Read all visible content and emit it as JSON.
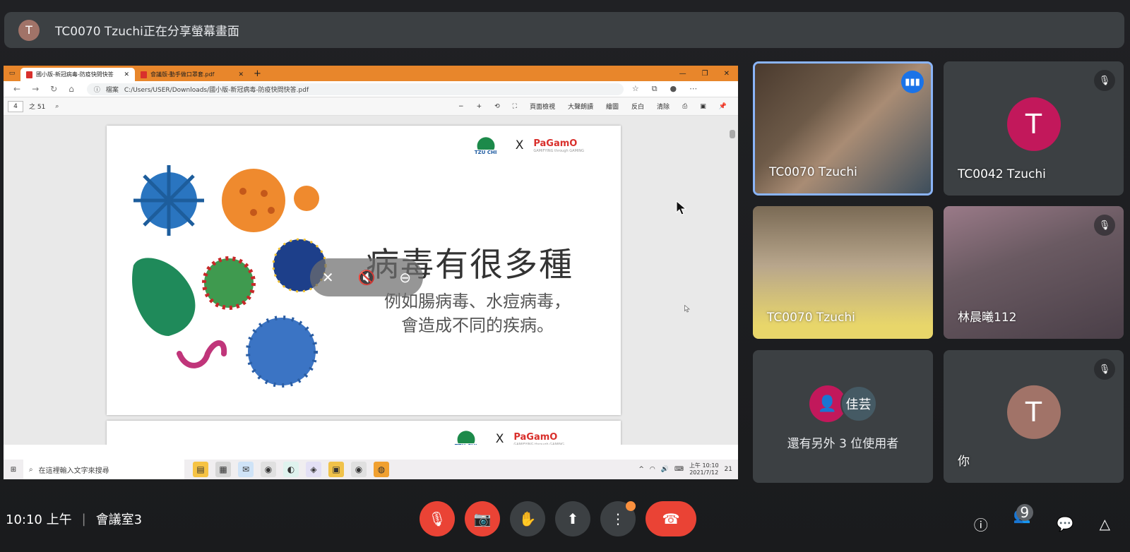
{
  "banner": {
    "avatar_letter": "T",
    "text": "TC0070 Tzuchi正在分享螢幕畫面"
  },
  "browser": {
    "tabs": [
      {
        "label": "國小版-新冠病毒-防疫快問快答"
      },
      {
        "label": "會議版-動手做口罩套.pdf"
      }
    ],
    "address_prefix": "檔案",
    "url": "C:/Users/USER/Downloads/國小版-新冠病毒-防疫快問快答.pdf",
    "page_current": "4",
    "page_total": "之 51",
    "toolbar": {
      "page_view": "頁面檢視",
      "read_aloud": "大聲朗讀",
      "draw": "繪圖",
      "highlight": "反白",
      "erase": "清除"
    }
  },
  "slide": {
    "logo_tzuchi": "TZU CHI",
    "logo_x": "X",
    "logo_pagamo": "PaGamO",
    "logo_pagamo_sub": "GAMIFYING through GAMING",
    "title": "病毒有很多種",
    "subtitle_line1": "例如腸病毒、水痘病毒，",
    "subtitle_line2": "會造成不同的疾病。"
  },
  "taskbar": {
    "search_placeholder": "在這裡輸入文字來搜尋",
    "time": "上午 10:10",
    "date": "2021/7/12",
    "notif_count": "21"
  },
  "participants": [
    {
      "name": "TC0070 Tzuchi",
      "speaking": true
    },
    {
      "name": "TC0042 Tzuchi",
      "avatar_letter": "T",
      "avatar_color": "#c2185b",
      "muted": true
    },
    {
      "name": "TC0070 Tzuchi"
    },
    {
      "name": "林晨曦112",
      "muted": true
    },
    {
      "others_text": "還有另外 3 位使用者",
      "avatar2_text": "佳芸"
    },
    {
      "name": "你",
      "avatar_letter": "T",
      "avatar_color": "#a17368",
      "muted": true
    }
  ],
  "bottom": {
    "time": "10:10 上午",
    "separator": "|",
    "room": "會議室3",
    "people_count": "9"
  }
}
